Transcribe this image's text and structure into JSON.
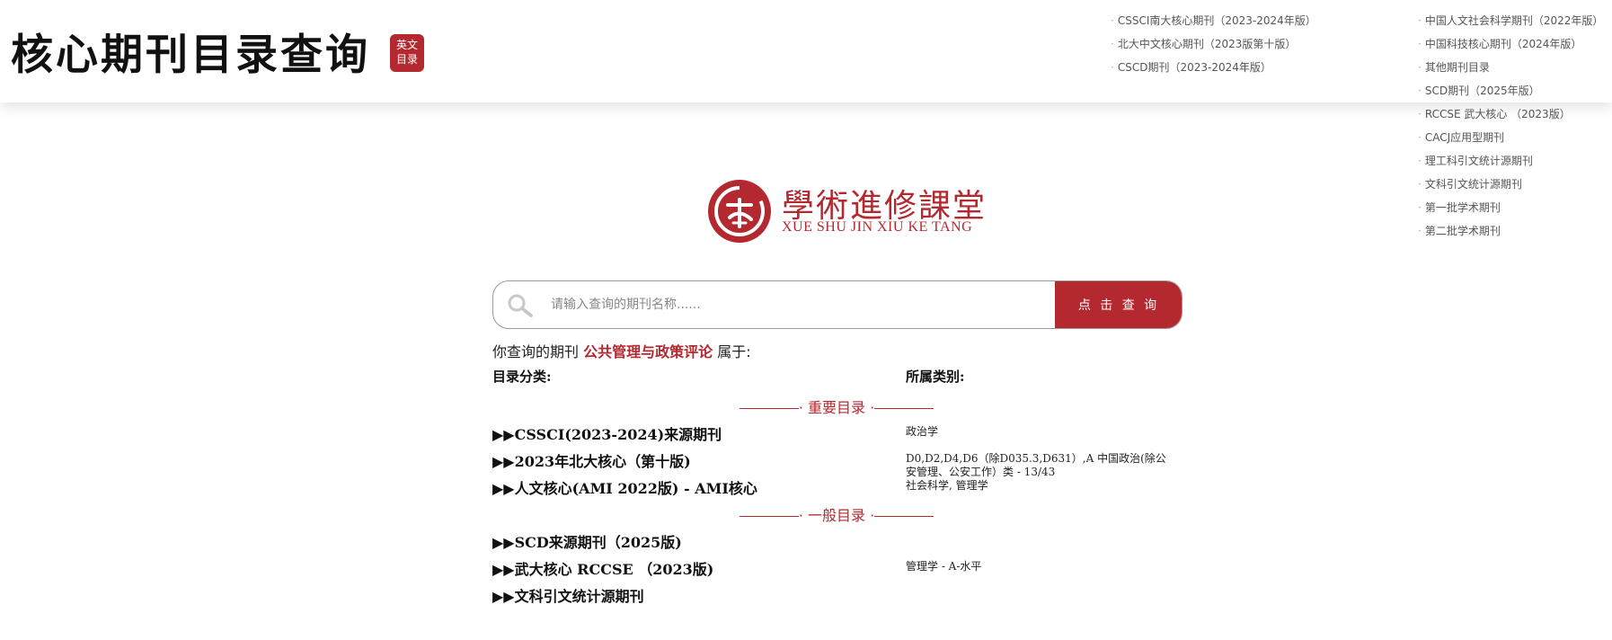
{
  "header": {
    "title": "核心期刊目录查询",
    "en_badge_line1": "英文",
    "en_badge_line2": "目录",
    "nav_col1": [
      "CSSCI南大核心期刊（2023-2024年版）",
      "北大中文核心期刊（2023版第十版）",
      "CSCD期刊（2023-2024年版）"
    ],
    "nav_col2": [
      "中国人文社会科学期刊（2022年版）",
      "中国科技核心期刊（2024年版）",
      "其他期刊目录",
      "SCD期刊（2025年版）",
      "RCCSE 武大核心 （2023版）",
      "CACJ应用型期刊",
      "理工科引文统计源期刊",
      "文科引文统计源期刊",
      "第一批学术期刊",
      "第二批学术期刊"
    ]
  },
  "logo": {
    "main_text": "學術進修課堂",
    "sub_text": "XUE SHU JIN XIU KE TANG",
    "brand_color": "#b3292f"
  },
  "search": {
    "placeholder": "请输入查询的期刊名称......",
    "value": "",
    "button_label": "点 击 查 询"
  },
  "result": {
    "prefix": "你查询的期刊",
    "journal_name": "公共管理与政策评论",
    "suffix": "属于:",
    "col_left_header": "目录分类:",
    "col_right_header": "所属类别:",
    "important_label": "· 重要目录 ·",
    "general_label": "· 一般目录 ·",
    "important_rows": [
      {
        "category": "▶▶CSSCI(2023-2024)来源期刊",
        "value": "政治学"
      },
      {
        "category": "▶▶2023年北大核心（第十版)",
        "value": "D0,D2,D4,D6（除D035.3,D631）,A 中国政治(除公安管理、公安工作）类 - 13/43"
      },
      {
        "category": "▶▶人文核心(AMI 2022版) - AMI核心",
        "value": "社会科学, 管理学"
      }
    ],
    "general_rows": [
      {
        "category": "▶▶SCD来源期刊（2025版)",
        "value": ""
      },
      {
        "category": "▶▶武大核心 RCCSE （2023版)",
        "value": "管理学 - A-水平"
      },
      {
        "category": "▶▶文科引文统计源期刊",
        "value": ""
      }
    ]
  }
}
